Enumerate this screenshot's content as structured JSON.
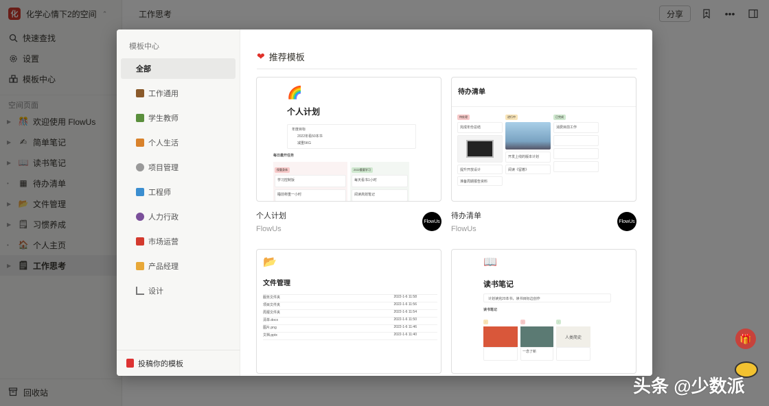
{
  "workspace": {
    "name": "化学心情下2的空间",
    "logo": "化"
  },
  "sidebar": {
    "actions": [
      {
        "label": "快速查找",
        "icon": "search-icon"
      },
      {
        "label": "设置",
        "icon": "gear-icon"
      },
      {
        "label": "模板中心",
        "icon": "template-icon"
      }
    ],
    "section_label": "空间页面",
    "pages": [
      {
        "label": "欢迎使用 FlowUs",
        "emoji": "🎊"
      },
      {
        "label": "简单笔记",
        "emoji": "✍"
      },
      {
        "label": "读书笔记",
        "emoji": "📖"
      },
      {
        "label": "待办清单",
        "emoji": "▦"
      },
      {
        "label": "文件管理",
        "emoji": "📂"
      },
      {
        "label": "习惯养成",
        "emoji": "🗒"
      },
      {
        "label": "个人主页",
        "emoji": "🏠"
      },
      {
        "label": "工作思考",
        "emoji": "🗒"
      }
    ],
    "trash_label": "回收站"
  },
  "topbar": {
    "title": "工作思考",
    "share_label": "分享"
  },
  "modal": {
    "title": "模板中心",
    "categories": [
      {
        "label": "全部",
        "color": ""
      },
      {
        "label": "工作通用",
        "color": "#8a5a2b"
      },
      {
        "label": "学生教师",
        "color": "#5a8f3c"
      },
      {
        "label": "个人生活",
        "color": "#d9822b"
      },
      {
        "label": "项目管理",
        "color": "#888888"
      },
      {
        "label": "工程师",
        "color": "#3b8ed0"
      },
      {
        "label": "人力行政",
        "color": "#7a4f9a"
      },
      {
        "label": "市场运营",
        "color": "#d33a2e"
      },
      {
        "label": "产品经理",
        "color": "#e8a838"
      },
      {
        "label": "设计",
        "color": "#777777"
      }
    ],
    "submit_label": "投稿你的模板",
    "recommend_title": "推荐模板",
    "cards": [
      {
        "name": "个人计划",
        "author": "FlowUs",
        "preview_title": "个人计划",
        "emoji": "🌈"
      },
      {
        "name": "待办清单",
        "author": "FlowUs",
        "preview_title": "待办清单",
        "emoji": ""
      },
      {
        "name": "",
        "author": "",
        "preview_title": "文件管理",
        "emoji": "📂"
      },
      {
        "name": "",
        "author": "",
        "preview_title": "读书笔记",
        "emoji": "📖"
      }
    ],
    "badge_text": "FlowUs"
  },
  "preview1": {
    "goal_label": "年度目标",
    "bullets": [
      "2022年看50本书",
      "减重5KG"
    ],
    "daily_label": "每日最开任务",
    "col1_tag": "保重身体",
    "col2_tag": "2022重要学习",
    "items": [
      "学习控制饭",
      "每天看书1小时",
      "睡前称重一小时",
      "阅读高效笔记"
    ]
  },
  "preview2": {
    "cols": [
      "待处理",
      "进行中",
      "已完成"
    ],
    "items": [
      "完成年份总结",
      "开发上线的版本计划",
      "提升开放设计",
      "准备周期报告资料",
      "阅读《留着》",
      "消费目前工作"
    ]
  },
  "preview3": {
    "rows": [
      "服务文件夹",
      "项目文件夹",
      "周报文件夹",
      "清单.docx",
      "图片.png",
      "文档.pptx"
    ],
    "dates": [
      "2022-1-6 11:58",
      "2022-1-6 11:56",
      "2022-1-6 11:54",
      "2022-1-6 11:50",
      "2022-1-6 11:46",
      "2022-1-6 11:40"
    ]
  },
  "preview4": {
    "note": "计划读完20本书，读书目标边创作",
    "books": [
      "一念了新",
      "人类简史"
    ],
    "section": "读书笔记"
  },
  "watermark": "头条 @少数派",
  "colors": {
    "accent_red": "#d23a2e",
    "heart": "#e0312a"
  }
}
